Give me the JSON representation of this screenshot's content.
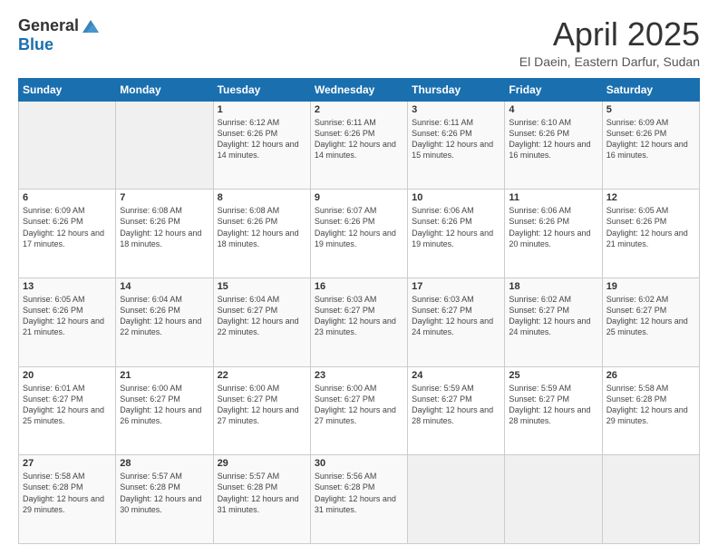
{
  "logo": {
    "general": "General",
    "blue": "Blue"
  },
  "title": {
    "month": "April 2025",
    "location": "El Daein, Eastern Darfur, Sudan"
  },
  "days_of_week": [
    "Sunday",
    "Monday",
    "Tuesday",
    "Wednesday",
    "Thursday",
    "Friday",
    "Saturday"
  ],
  "weeks": [
    [
      {
        "day": "",
        "info": ""
      },
      {
        "day": "",
        "info": ""
      },
      {
        "day": "1",
        "info": "Sunrise: 6:12 AM\nSunset: 6:26 PM\nDaylight: 12 hours and 14 minutes."
      },
      {
        "day": "2",
        "info": "Sunrise: 6:11 AM\nSunset: 6:26 PM\nDaylight: 12 hours and 14 minutes."
      },
      {
        "day": "3",
        "info": "Sunrise: 6:11 AM\nSunset: 6:26 PM\nDaylight: 12 hours and 15 minutes."
      },
      {
        "day": "4",
        "info": "Sunrise: 6:10 AM\nSunset: 6:26 PM\nDaylight: 12 hours and 16 minutes."
      },
      {
        "day": "5",
        "info": "Sunrise: 6:09 AM\nSunset: 6:26 PM\nDaylight: 12 hours and 16 minutes."
      }
    ],
    [
      {
        "day": "6",
        "info": "Sunrise: 6:09 AM\nSunset: 6:26 PM\nDaylight: 12 hours and 17 minutes."
      },
      {
        "day": "7",
        "info": "Sunrise: 6:08 AM\nSunset: 6:26 PM\nDaylight: 12 hours and 18 minutes."
      },
      {
        "day": "8",
        "info": "Sunrise: 6:08 AM\nSunset: 6:26 PM\nDaylight: 12 hours and 18 minutes."
      },
      {
        "day": "9",
        "info": "Sunrise: 6:07 AM\nSunset: 6:26 PM\nDaylight: 12 hours and 19 minutes."
      },
      {
        "day": "10",
        "info": "Sunrise: 6:06 AM\nSunset: 6:26 PM\nDaylight: 12 hours and 19 minutes."
      },
      {
        "day": "11",
        "info": "Sunrise: 6:06 AM\nSunset: 6:26 PM\nDaylight: 12 hours and 20 minutes."
      },
      {
        "day": "12",
        "info": "Sunrise: 6:05 AM\nSunset: 6:26 PM\nDaylight: 12 hours and 21 minutes."
      }
    ],
    [
      {
        "day": "13",
        "info": "Sunrise: 6:05 AM\nSunset: 6:26 PM\nDaylight: 12 hours and 21 minutes."
      },
      {
        "day": "14",
        "info": "Sunrise: 6:04 AM\nSunset: 6:26 PM\nDaylight: 12 hours and 22 minutes."
      },
      {
        "day": "15",
        "info": "Sunrise: 6:04 AM\nSunset: 6:27 PM\nDaylight: 12 hours and 22 minutes."
      },
      {
        "day": "16",
        "info": "Sunrise: 6:03 AM\nSunset: 6:27 PM\nDaylight: 12 hours and 23 minutes."
      },
      {
        "day": "17",
        "info": "Sunrise: 6:03 AM\nSunset: 6:27 PM\nDaylight: 12 hours and 24 minutes."
      },
      {
        "day": "18",
        "info": "Sunrise: 6:02 AM\nSunset: 6:27 PM\nDaylight: 12 hours and 24 minutes."
      },
      {
        "day": "19",
        "info": "Sunrise: 6:02 AM\nSunset: 6:27 PM\nDaylight: 12 hours and 25 minutes."
      }
    ],
    [
      {
        "day": "20",
        "info": "Sunrise: 6:01 AM\nSunset: 6:27 PM\nDaylight: 12 hours and 25 minutes."
      },
      {
        "day": "21",
        "info": "Sunrise: 6:00 AM\nSunset: 6:27 PM\nDaylight: 12 hours and 26 minutes."
      },
      {
        "day": "22",
        "info": "Sunrise: 6:00 AM\nSunset: 6:27 PM\nDaylight: 12 hours and 27 minutes."
      },
      {
        "day": "23",
        "info": "Sunrise: 6:00 AM\nSunset: 6:27 PM\nDaylight: 12 hours and 27 minutes."
      },
      {
        "day": "24",
        "info": "Sunrise: 5:59 AM\nSunset: 6:27 PM\nDaylight: 12 hours and 28 minutes."
      },
      {
        "day": "25",
        "info": "Sunrise: 5:59 AM\nSunset: 6:27 PM\nDaylight: 12 hours and 28 minutes."
      },
      {
        "day": "26",
        "info": "Sunrise: 5:58 AM\nSunset: 6:28 PM\nDaylight: 12 hours and 29 minutes."
      }
    ],
    [
      {
        "day": "27",
        "info": "Sunrise: 5:58 AM\nSunset: 6:28 PM\nDaylight: 12 hours and 29 minutes."
      },
      {
        "day": "28",
        "info": "Sunrise: 5:57 AM\nSunset: 6:28 PM\nDaylight: 12 hours and 30 minutes."
      },
      {
        "day": "29",
        "info": "Sunrise: 5:57 AM\nSunset: 6:28 PM\nDaylight: 12 hours and 31 minutes."
      },
      {
        "day": "30",
        "info": "Sunrise: 5:56 AM\nSunset: 6:28 PM\nDaylight: 12 hours and 31 minutes."
      },
      {
        "day": "",
        "info": ""
      },
      {
        "day": "",
        "info": ""
      },
      {
        "day": "",
        "info": ""
      }
    ]
  ]
}
